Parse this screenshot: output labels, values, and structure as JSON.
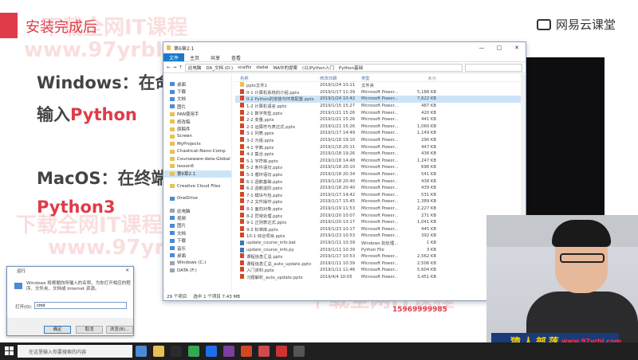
{
  "slide": {
    "title": "安装完成后",
    "brand": "网易云课堂",
    "line1": "Windows：在命",
    "line2_prefix": "输入",
    "line2_red": "Python",
    "line3": "MacOS：在终端",
    "line4": "Python3",
    "phone": "15969999985",
    "watermarks": [
      "下载全网IT课程",
      "www.97yrbl.com"
    ]
  },
  "explorer": {
    "title": "第6章2.1",
    "ribbon": [
      "文件",
      "主页",
      "共享",
      "查看"
    ],
    "address": [
      "此电脑",
      "DA_文档 (D:)",
      "scalfiz",
      "dadai",
      "MA中的提案",
      "(以)Python入门",
      "Python基础"
    ],
    "columns": {
      "name": "名称",
      "date": "修改日期",
      "type": "类型",
      "size": "大小"
    },
    "nav": [
      {
        "label": "桌面",
        "kind": "blue"
      },
      {
        "label": "下载",
        "kind": "blue"
      },
      {
        "label": "文档",
        "kind": "blue"
      },
      {
        "label": "图片",
        "kind": "blue"
      },
      {
        "label": "PAN使用手",
        "kind": "folder"
      },
      {
        "label": "修改稿",
        "kind": "folder"
      },
      {
        "label": "原稿件",
        "kind": "folder"
      },
      {
        "label": "Screen",
        "kind": "folder"
      },
      {
        "label": "MyProjects",
        "kind": "folder"
      },
      {
        "label": "Chaoticat-Nano-Comp",
        "kind": "folder"
      },
      {
        "label": "Courseware-data-Global",
        "kind": "folder"
      },
      {
        "label": "lesson6",
        "kind": "folder"
      },
      {
        "label": "第6章2.1",
        "kind": "folder"
      },
      {
        "label": "",
        "kind": "gap"
      },
      {
        "label": "Creative Cloud Files",
        "kind": "folder"
      },
      {
        "label": "",
        "kind": "gap"
      },
      {
        "label": "OneDrive",
        "kind": "blue"
      },
      {
        "label": "",
        "kind": "gap"
      },
      {
        "label": "此电脑",
        "kind": "drive"
      },
      {
        "label": "视频",
        "kind": "blue"
      },
      {
        "label": "图片",
        "kind": "blue"
      },
      {
        "label": "文档",
        "kind": "blue"
      },
      {
        "label": "下载",
        "kind": "blue"
      },
      {
        "label": "音乐",
        "kind": "blue"
      },
      {
        "label": "桌面",
        "kind": "blue"
      },
      {
        "label": "Windows (C:)",
        "kind": "drive"
      },
      {
        "label": "DATA (F:)",
        "kind": "drive"
      }
    ],
    "files": [
      {
        "name": "pptx文件1",
        "date": "2019/1/24 10:11",
        "type": "文件夹",
        "size": "",
        "icon": "folder"
      },
      {
        "name": "0-1 计算机系统的介绍.pptx",
        "date": "2019/1/17 11:39",
        "type": "Microsoft Power...",
        "size": "5,188 KB",
        "icon": "ppt"
      },
      {
        "name": "0-2 Python的安装与环境配置.pptx",
        "date": "2019/1/24 10:42",
        "type": "Microsoft Power...",
        "size": "7,622 KB",
        "icon": "ppt"
      },
      {
        "name": "1-2 计算机语言.pptx",
        "date": "2019/1/15 15:27",
        "type": "Microsoft Power...",
        "size": "487 KB",
        "icon": "ppt"
      },
      {
        "name": "2-1 数字类型.pptx",
        "date": "2019/1/21 15:26",
        "type": "Microsoft Power...",
        "size": "420 KB",
        "icon": "ppt"
      },
      {
        "name": "2-2 变量.pptx",
        "date": "2019/1/21 15:26",
        "type": "Microsoft Power...",
        "size": "441 KB",
        "icon": "ppt"
      },
      {
        "name": "2-3 运算符与表达式.pptx",
        "date": "2019/1/21 15:26",
        "type": "Microsoft Power...",
        "size": "1,060 KB",
        "icon": "ppt"
      },
      {
        "name": "3-1 列表.pptx",
        "date": "2019/1/17 14:49",
        "type": "Microsoft Power...",
        "size": "1,149 KB",
        "icon": "ppt"
      },
      {
        "name": "3-2 元组.pptx",
        "date": "2019/1/18 19:10",
        "type": "Microsoft Power...",
        "size": "290 KB",
        "icon": "ppt"
      },
      {
        "name": "4-1 字典.pptx",
        "date": "2019/1/18 20:11",
        "type": "Microsoft Power...",
        "size": "447 KB",
        "icon": "ppt"
      },
      {
        "name": "4-2 集合.pptx",
        "date": "2019/1/18 19:26",
        "type": "Microsoft Power...",
        "size": "436 KB",
        "icon": "ppt"
      },
      {
        "name": "5-1 字符串.pptx",
        "date": "2019/1/18 14:48",
        "type": "Microsoft Power...",
        "size": "1,247 KB",
        "icon": "ppt"
      },
      {
        "name": "5-2 条件语句.pptx",
        "date": "2019/1/18 20:10",
        "type": "Microsoft Power...",
        "size": "696 KB",
        "icon": "ppt"
      },
      {
        "name": "5-3 循环语句.pptx",
        "date": "2019/1/18 20:34",
        "type": "Microsoft Power...",
        "size": "541 KB",
        "icon": "ppt"
      },
      {
        "name": "6-1 函数基础.pptx",
        "date": "2019/1/18 20:40",
        "type": "Microsoft Power...",
        "size": "438 KB",
        "icon": "ppt"
      },
      {
        "name": "6-2 函数进阶.pptx",
        "date": "2019/1/18 20:40",
        "type": "Microsoft Power...",
        "size": "439 KB",
        "icon": "ppt"
      },
      {
        "name": "7-1 模块与包.pptx",
        "date": "2019/1/17 14:42",
        "type": "Microsoft Power...",
        "size": "531 KB",
        "icon": "ppt"
      },
      {
        "name": "7-2 文件操作.pptx",
        "date": "2019/1/17 15:45",
        "type": "Microsoft Power...",
        "size": "1,389 KB",
        "icon": "ppt"
      },
      {
        "name": "8-1 面向对象.pptx",
        "date": "2019/1/19 11:53",
        "type": "Microsoft Power...",
        "size": "2,227 KB",
        "icon": "ppt"
      },
      {
        "name": "8-2 异常处理.pptx",
        "date": "2019/1/20 10:07",
        "type": "Microsoft Power...",
        "size": "271 KB",
        "icon": "ppt"
      },
      {
        "name": "9-1 正则表达式.pptx",
        "date": "2019/1/20 13:17",
        "type": "Microsoft Power...",
        "size": "1,041 KB",
        "icon": "ppt"
      },
      {
        "name": "9-2 标准库.pptx",
        "date": "2019/1/23 10:17",
        "type": "Microsoft Power...",
        "size": "445 KB",
        "icon": "ppt"
      },
      {
        "name": "10-1 综合项目.pptx",
        "date": "2019/1/23 10:53",
        "type": "Microsoft Power...",
        "size": "392 KB",
        "icon": "ppt"
      },
      {
        "name": "update_course_info.bat",
        "date": "2019/1/11 10:39",
        "type": "Windows 批处理...",
        "size": "1 KB",
        "icon": "py"
      },
      {
        "name": "update_course_info.py",
        "date": "2019/1/11 10:39",
        "type": "Python File",
        "size": "3 KB",
        "icon": "py"
      },
      {
        "name": "课程信息汇总.pptx",
        "date": "2019/1/17 10:53",
        "type": "Microsoft Power...",
        "size": "2,562 KB",
        "icon": "ppt"
      },
      {
        "name": "课程信息汇总_auto_update.pptx",
        "date": "2019/1/11 10:39",
        "type": "Microsoft Power...",
        "size": "2,506 KB",
        "icon": "ppt"
      },
      {
        "name": "入门资料.pptx",
        "date": "2019/1/11 11:46",
        "type": "Microsoft Power...",
        "size": "5,604 KB",
        "icon": "ppt"
      },
      {
        "name": "习题解析_auto_update.pptx",
        "date": "2019/4/4 10:05",
        "type": "Microsoft Power...",
        "size": "3,451 KB",
        "icon": "ppt"
      }
    ],
    "status": [
      "29 个项目",
      "选中 1 个项目 7.43 MB"
    ]
  },
  "run_dialog": {
    "title": "运行",
    "message": "Windows 将根据你所输入的名称，为你打开相应的程序、文件夹、文档或 Internet 资源。",
    "open_label": "打开(O):",
    "input_value": "cmd",
    "ok": "确定",
    "cancel": "取消",
    "browse": "浏览(B)..."
  },
  "taskbar": {
    "search_placeholder": "在这里输入你要搜索的内容",
    "icon_colors": [
      "#4a8bd6",
      "#e6c158",
      "#2b2b2b",
      "#34a853",
      "#1f6feb",
      "#7b3fa0",
      "#d24726",
      "#cf4a4a",
      "#c33",
      "#555"
    ]
  },
  "cam_banner": {
    "brand": "猿人部落",
    "url": "www.97yrbl.com"
  }
}
